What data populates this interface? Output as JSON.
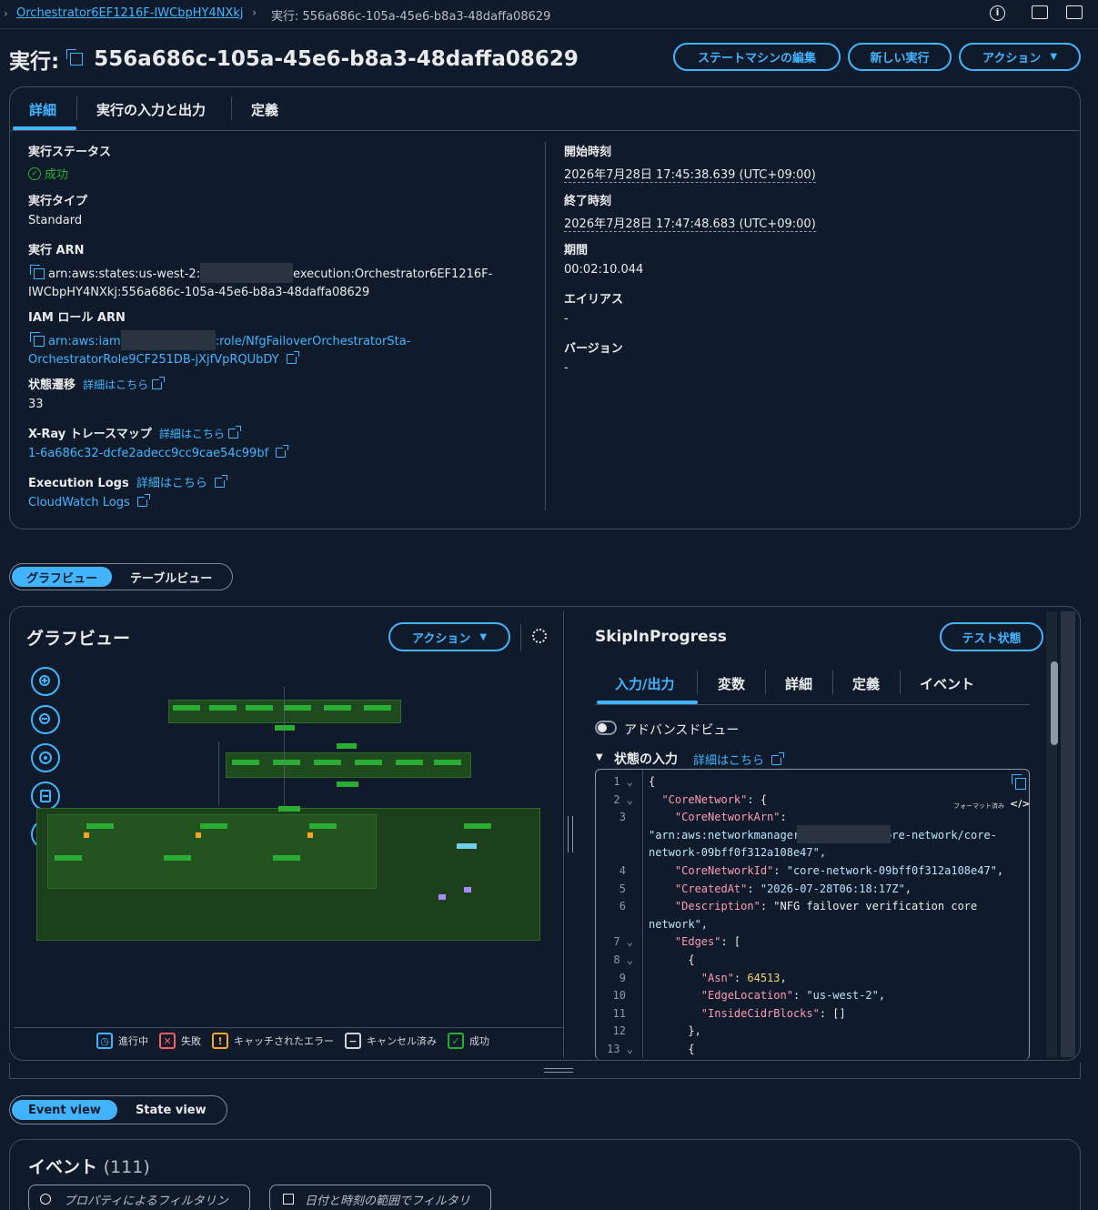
{
  "breadcrumb": {
    "parent": "Orchestrator6EF1216F-IWCbpHY4NXkj",
    "current": "実行: 556a686c-105a-45e6-b8a3-48daffa08629"
  },
  "header": {
    "title_prefix": "実行:",
    "title_id": "556a686c-105a-45e6-b8a3-48daffa08629",
    "edit_btn": "ステートマシンの編集",
    "new_btn": "新しい実行",
    "action_btn": "アクション"
  },
  "tabs": [
    "詳細",
    "実行の入力と出力",
    "定義"
  ],
  "details": {
    "status_label": "実行ステータス",
    "status_value": "成功",
    "type_label": "実行タイプ",
    "type_value": "Standard",
    "arn_label": "実行 ARN",
    "arn_part1": "arn:aws:states:us-west-2:",
    "arn_part2": "execution:Orchestrator6EF1216F-",
    "arn_part3": "IWCbpHY4NXkj:556a686c-105a-45e6-b8a3-48daffa08629",
    "iam_label": "IAM ロール ARN",
    "iam_part1": "arn:aws:iam",
    "iam_part2": ":role/NfgFailoverOrchestratorSta-",
    "iam_part3": "OrchestratorRole9CF251DB-jXjfVpRQUbDY",
    "transitions_label": "状態遷移",
    "learn_more": "詳細はこちら",
    "transitions_value": "33",
    "xray_label": "X-Ray トレースマップ",
    "xray_value": "1-6a686c32-dcfe2adecc9cc9cae54c99bf",
    "logs_label": "Execution Logs",
    "logs_value": "CloudWatch Logs",
    "start_label": "開始時刻",
    "start_value": "2026年7月28日 17:45:38.639 (UTC+09:00)",
    "end_label": "終了時刻",
    "end_value": "2026年7月28日 17:47:48.683 (UTC+09:00)",
    "duration_label": "期間",
    "duration_value": "00:02:10.044",
    "alias_label": "エイリアス",
    "alias_value": "-",
    "version_label": "バージョン",
    "version_value": "-"
  },
  "view_toggle": {
    "graph": "グラフビュー",
    "table": "テーブルビュー"
  },
  "graph": {
    "title": "グラフビュー",
    "action": "アクション"
  },
  "legend": [
    {
      "label": "進行中",
      "color": "#42b4ff",
      "glyph": "◷"
    },
    {
      "label": "失敗",
      "color": "#ff5d64",
      "glyph": "✕"
    },
    {
      "label": "キャッチされたエラー",
      "color": "#f5a623",
      "glyph": "!"
    },
    {
      "label": "キャンセル済み",
      "color": "#d1d5db",
      "glyph": "−"
    },
    {
      "label": "成功",
      "color": "#29ad32",
      "glyph": "✓"
    }
  ],
  "state": {
    "title": "SkipInProgress",
    "test_btn": "テスト状態",
    "tabs": [
      "入力/出力",
      "変数",
      "詳細",
      "定義",
      "イベント"
    ],
    "advanced": "アドバンスドビュー",
    "input_title": "状態の入力",
    "learn_more": "詳細はこちら",
    "format_label": "フォーマット済み"
  },
  "code": [
    {
      "n": "1",
      "t": "{"
    },
    {
      "n": "2",
      "t": "  \"CoreNetwork\": {"
    },
    {
      "n": "3",
      "t": "    \"CoreNetworkArn\":"
    },
    {
      "n": "",
      "t": "\"arn:aws:networkmanager            core-network/core-"
    },
    {
      "n": "",
      "t": "network-09bff0f312a108e47\","
    },
    {
      "n": "4",
      "t": "    \"CoreNetworkId\": \"core-network-09bff0f312a108e47\","
    },
    {
      "n": "5",
      "t": "    \"CreatedAt\": \"2026-07-28T06:18:17Z\","
    },
    {
      "n": "6",
      "t": "    \"Description\": \"NFG failover verification core"
    },
    {
      "n": "",
      "t": "network\","
    },
    {
      "n": "7",
      "t": "    \"Edges\": ["
    },
    {
      "n": "8",
      "t": "      {"
    },
    {
      "n": "9",
      "t": "        \"Asn\": 64513,"
    },
    {
      "n": "10",
      "t": "        \"EdgeLocation\": \"us-west-2\","
    },
    {
      "n": "11",
      "t": "        \"InsideCidrBlocks\": []"
    },
    {
      "n": "12",
      "t": "      },"
    },
    {
      "n": "13",
      "t": "      {"
    }
  ],
  "events_toggle": {
    "event": "Event view",
    "state": "State view"
  },
  "events": {
    "title": "イベント",
    "count": "(111)",
    "filter_props": "プロパティによるフィルタリン",
    "filter_date": "日付と時刻の範囲でフィルタリ"
  }
}
